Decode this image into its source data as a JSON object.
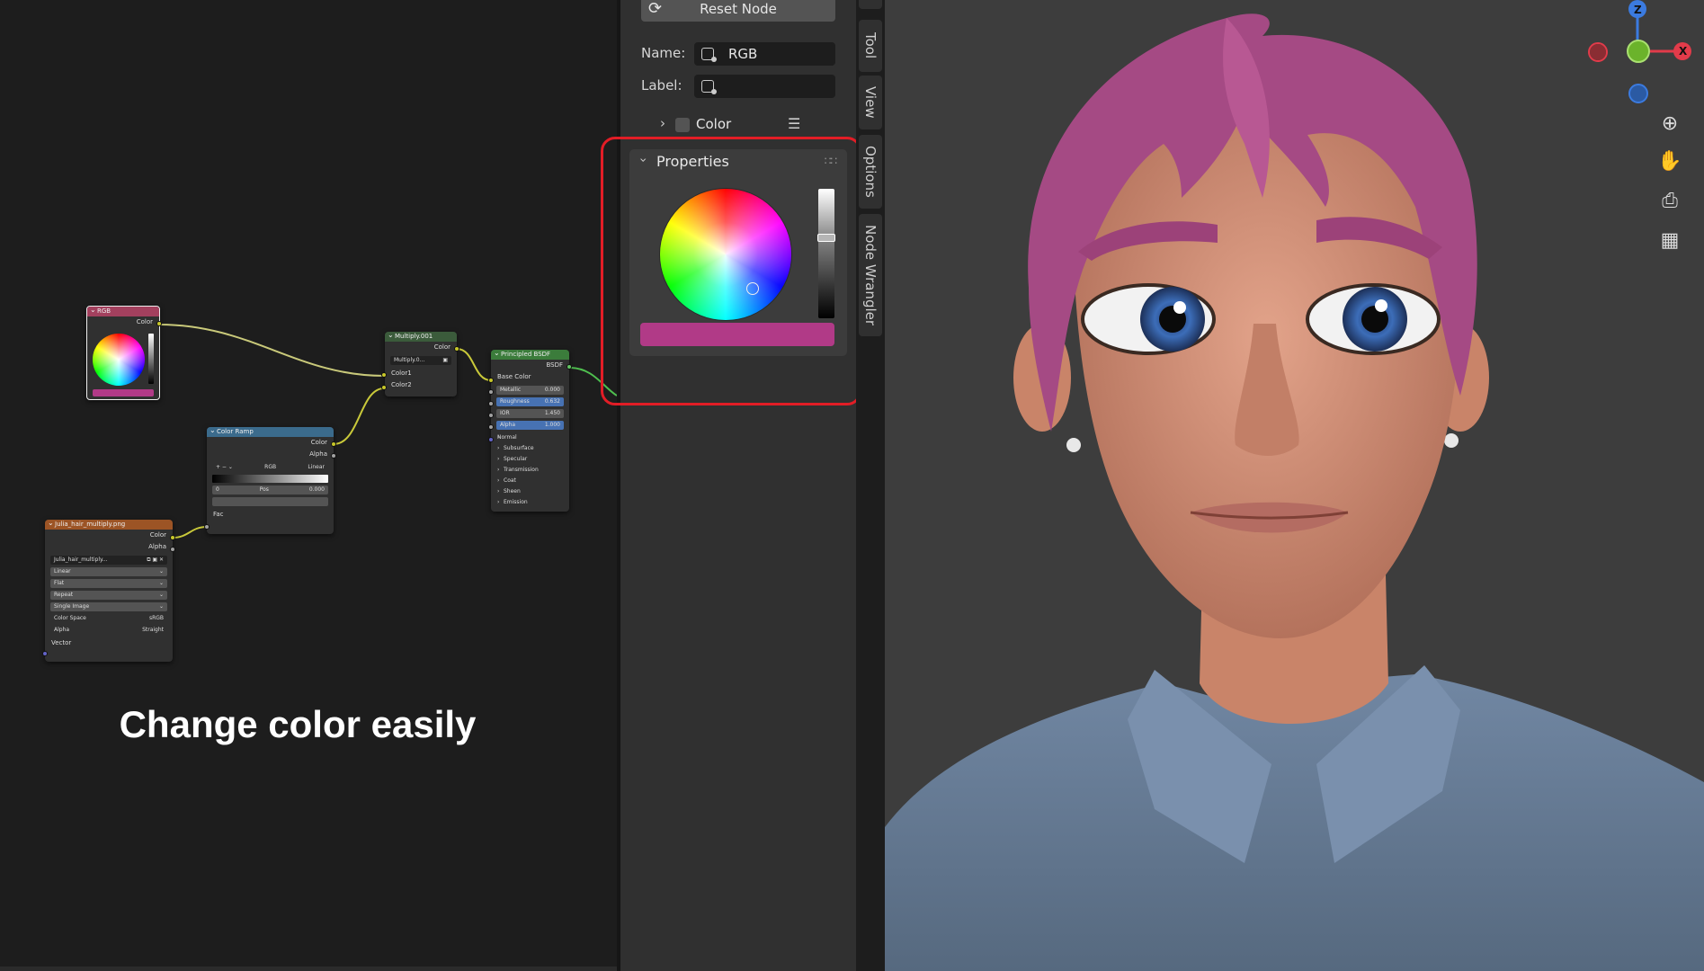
{
  "node_editor": {
    "caption": "Change color easily",
    "rgb_node": {
      "title": "RGB",
      "output": "Color"
    },
    "multiply_node": {
      "title": "Multiply.001",
      "output": "Color",
      "field": "Multiply.0...",
      "inputs": [
        "Color1",
        "Color2"
      ]
    },
    "principled_node": {
      "title": "Principled BSDF",
      "output": "BSDF",
      "base_color": "Base Color",
      "fields": [
        {
          "label": "Metallic",
          "value": "0.000",
          "highlight": false
        },
        {
          "label": "Roughness",
          "value": "0.632",
          "highlight": true
        },
        {
          "label": "IOR",
          "value": "1.450",
          "highlight": false
        },
        {
          "label": "Alpha",
          "value": "1.000",
          "highlight": true
        }
      ],
      "normal": "Normal",
      "panels": [
        "Subsurface",
        "Specular",
        "Transmission",
        "Coat",
        "Sheen",
        "Emission"
      ]
    },
    "colorramp_node": {
      "title": "Color Ramp",
      "outputs": [
        "Color",
        "Alpha"
      ],
      "mode": "RGB",
      "interp": "Linear",
      "index": "0",
      "pos_label": "Pos",
      "pos_value": "0.000",
      "input": "Fac"
    },
    "image_node": {
      "title": "Julia_hair_multiply.png",
      "outputs": [
        "Color",
        "Alpha"
      ],
      "image": "Julia_hair_multiply...",
      "dropdowns": [
        "Linear",
        "Flat",
        "Repeat",
        "Single Image"
      ],
      "color_space_label": "Color Space",
      "color_space": "sRGB",
      "alpha_label": "Alpha",
      "alpha": "Straight",
      "input": "Vector"
    }
  },
  "properties": {
    "reset_button": "Reset Node",
    "name_label": "Name:",
    "name_value": "RGB",
    "label_label": "Label:",
    "label_value": "",
    "color_section": "Color",
    "properties_section": "Properties",
    "swatch_color": "#b13a87"
  },
  "side_tabs": [
    "Tool",
    "View",
    "Options",
    "Node Wrangler"
  ],
  "viewport": {
    "gizmo": {
      "z": "Z",
      "x": "X"
    },
    "nav_icons": [
      "zoom-icon",
      "hand-icon",
      "camera-icon",
      "grid-icon"
    ]
  }
}
